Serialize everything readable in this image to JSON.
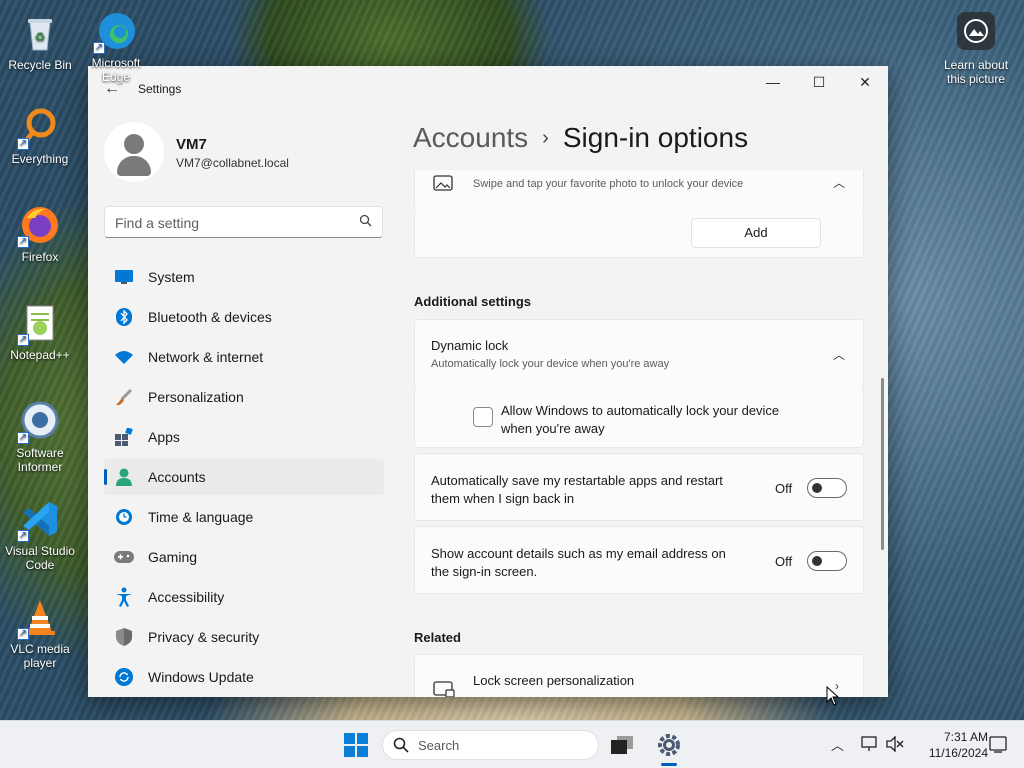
{
  "desktop": {
    "icons": [
      {
        "label": "Recycle Bin",
        "icon": "recycle-bin-icon"
      },
      {
        "label": "Microsoft Edge",
        "icon": "edge-icon"
      },
      {
        "label": "Everything",
        "icon": "everything-search-icon"
      },
      {
        "label": "Firefox",
        "icon": "firefox-icon"
      },
      {
        "label": "Notepad++",
        "icon": "notepadpp-icon"
      },
      {
        "label": "Software Informer",
        "icon": "software-informer-icon"
      },
      {
        "label": "Visual Studio Code",
        "icon": "vscode-icon"
      },
      {
        "label": "VLC media player",
        "icon": "vlc-icon"
      }
    ],
    "learn_label": "Learn about this picture"
  },
  "window": {
    "app_title": "Settings",
    "controls": {
      "minimize": "—",
      "maximize": "☐",
      "close": "✕"
    }
  },
  "profile": {
    "name": "VM7",
    "email": "VM7@collabnet.local"
  },
  "search": {
    "placeholder": "Find a setting"
  },
  "nav": {
    "items": [
      {
        "label": "System",
        "icon": "system-monitor-icon",
        "color": "#0078d4"
      },
      {
        "label": "Bluetooth & devices",
        "icon": "bluetooth-icon",
        "color": "#0078d4"
      },
      {
        "label": "Network & internet",
        "icon": "wifi-icon",
        "color": "#0078d4"
      },
      {
        "label": "Personalization",
        "icon": "paintbrush-icon",
        "color": "#c76b2a"
      },
      {
        "label": "Apps",
        "icon": "apps-icon",
        "color": "#4a5a72"
      },
      {
        "label": "Accounts",
        "icon": "accounts-person-icon",
        "color": "#2aa57a"
      },
      {
        "label": "Time & language",
        "icon": "globe-clock-icon",
        "color": "#0078d4"
      },
      {
        "label": "Gaming",
        "icon": "gamepad-icon",
        "color": "#6b6b6b"
      },
      {
        "label": "Accessibility",
        "icon": "accessibility-icon",
        "color": "#0078d4"
      },
      {
        "label": "Privacy & security",
        "icon": "shield-icon",
        "color": "#6b6b6b"
      },
      {
        "label": "Windows Update",
        "icon": "update-icon",
        "color": "#0078d4"
      }
    ],
    "active": "Accounts"
  },
  "breadcrumb": {
    "parent": "Accounts",
    "separator": "›",
    "current": "Sign-in options"
  },
  "picture_password": {
    "desc": "Swipe and tap your favorite photo to unlock your device",
    "add_label": "Add"
  },
  "additional": {
    "heading": "Additional settings",
    "dynamic_lock": {
      "title": "Dynamic lock",
      "desc": "Automatically lock your device when you're away",
      "checkbox_label_1": "Allow Windows to automatically lock your device",
      "checkbox_label_2": "when you're away",
      "checked": false
    },
    "restart_apps": {
      "line1": "Automatically save my restartable apps and restart",
      "line2": "them when I sign back in",
      "state": "Off"
    },
    "account_details": {
      "line1": "Show account details such as my email address on",
      "line2": "the sign-in screen.",
      "state": "Off"
    }
  },
  "related": {
    "heading": "Related",
    "lock_screen": {
      "title": "Lock screen personalization"
    }
  },
  "taskbar": {
    "search_label": "Search",
    "time": "7:31 AM",
    "date": "11/16/2024",
    "accent": "#005fb8"
  }
}
